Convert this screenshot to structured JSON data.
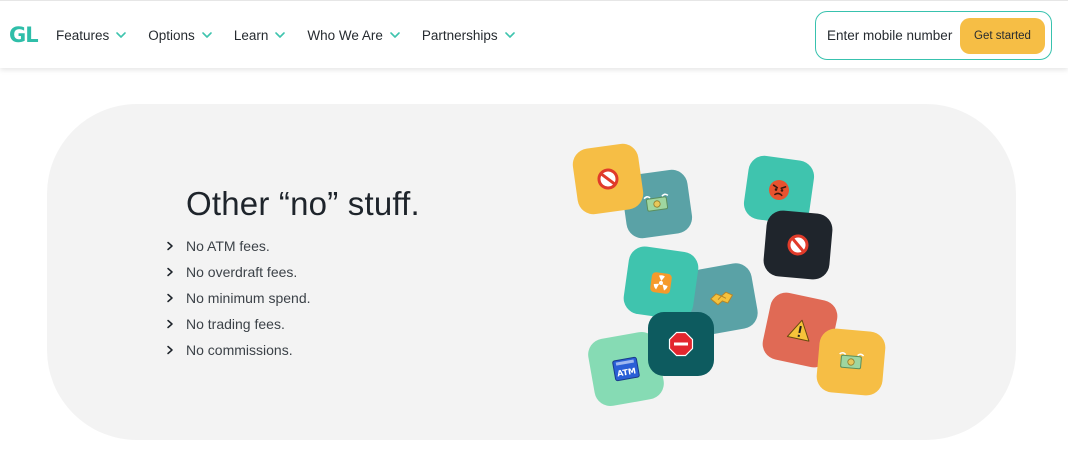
{
  "header": {
    "logo": "GL",
    "nav": [
      {
        "label": "Features"
      },
      {
        "label": "Options"
      },
      {
        "label": "Learn"
      },
      {
        "label": "Who We Are"
      },
      {
        "label": "Partnerships"
      }
    ],
    "signup": {
      "placeholder": "Enter mobile number",
      "button_label": "Get started"
    }
  },
  "main": {
    "title": "Other “no” stuff.",
    "features": [
      "No ATM fees.",
      "No overdraft fees.",
      "No minimum spend.",
      "No trading fees.",
      "No commissions."
    ]
  },
  "tiles": [
    {
      "icon": "prohibited-icon",
      "color": "#f6be45"
    },
    {
      "icon": "money-with-wings-icon",
      "color": "#5aa2a6"
    },
    {
      "icon": "angry-face-icon",
      "color": "#3fc4ae"
    },
    {
      "icon": "prohibited-icon",
      "color": "#1f252c"
    },
    {
      "icon": "radioactive-icon",
      "color": "#3fc4ae"
    },
    {
      "icon": "handshake-icon",
      "color": "#5aa2a6"
    },
    {
      "icon": "warning-icon",
      "color": "#e06a55"
    },
    {
      "icon": "stop-sign-icon",
      "color": "#0d5b5f"
    },
    {
      "icon": "atm-sign-icon",
      "color": "#86dbb4"
    },
    {
      "icon": "money-with-wings-icon",
      "color": "#f6be45"
    }
  ],
  "colors": {
    "accent": "#3fc4ae",
    "cta": "#f6be45",
    "card_bg": "#f3f3f3",
    "text": "#1e242b"
  }
}
